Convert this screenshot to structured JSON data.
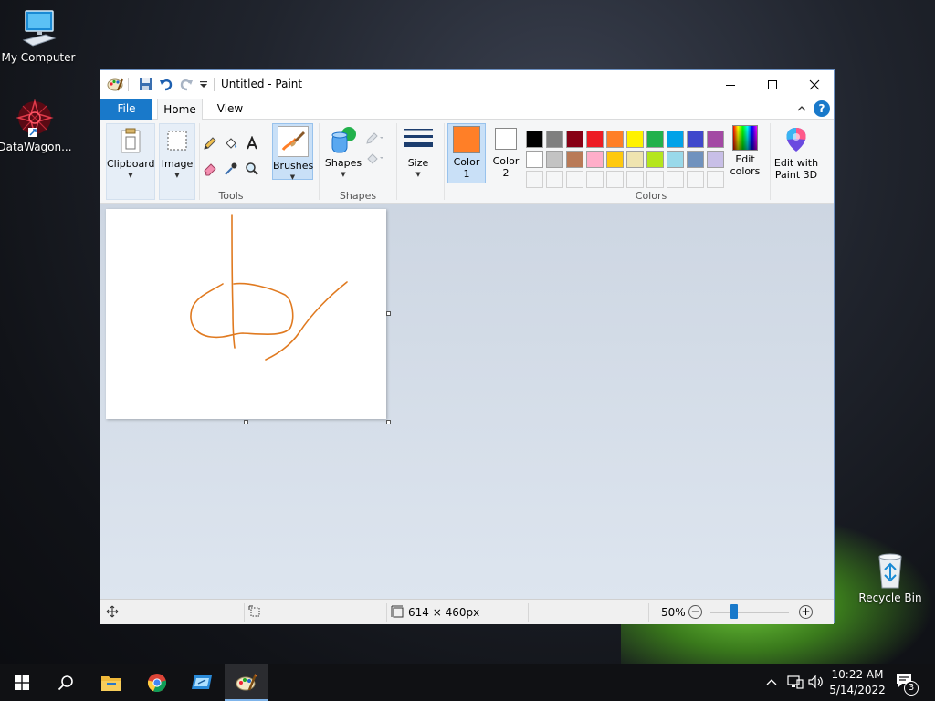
{
  "desktop": {
    "icons": [
      {
        "label": "My Computer"
      },
      {
        "label": "DataWagon..."
      },
      {
        "label": "Recycle Bin"
      }
    ]
  },
  "window": {
    "title": "Untitled - Paint",
    "tabs": {
      "file": "File",
      "home": "Home",
      "view": "View"
    },
    "help": "?"
  },
  "ribbon": {
    "clipboard": "Clipboard",
    "image": "Image",
    "tools_group": "Tools",
    "brushes": "Brushes",
    "shapes": "Shapes",
    "shapes_group": "Shapes",
    "size": "Size",
    "color1": {
      "line1": "Color",
      "line2": "1",
      "value": "#ff7f27"
    },
    "color2": {
      "line1": "Color",
      "line2": "2",
      "value": "#ffffff"
    },
    "colors_group": "Colors",
    "edit_colors": {
      "line1": "Edit",
      "line2": "colors"
    },
    "edit_paint3d": {
      "line1": "Edit with",
      "line2": "Paint 3D"
    },
    "palette_row1": [
      "#000000",
      "#7f7f7f",
      "#880015",
      "#ed1c24",
      "#ff7f27",
      "#fff200",
      "#22b14c",
      "#00a2e8",
      "#3f48cc",
      "#a349a4"
    ],
    "palette_row2": [
      "#ffffff",
      "#c3c3c3",
      "#b97a57",
      "#ffaec9",
      "#ffc90e",
      "#efe4b0",
      "#b5e61d",
      "#99d9ea",
      "#7092be",
      "#c8bfe7"
    ]
  },
  "status": {
    "dimensions": "614 × 460px",
    "zoom": "50%",
    "zoom_fraction": 0.5
  },
  "taskbar": {
    "time": "10:22 AM",
    "date": "5/14/2022",
    "notifications": "3"
  }
}
